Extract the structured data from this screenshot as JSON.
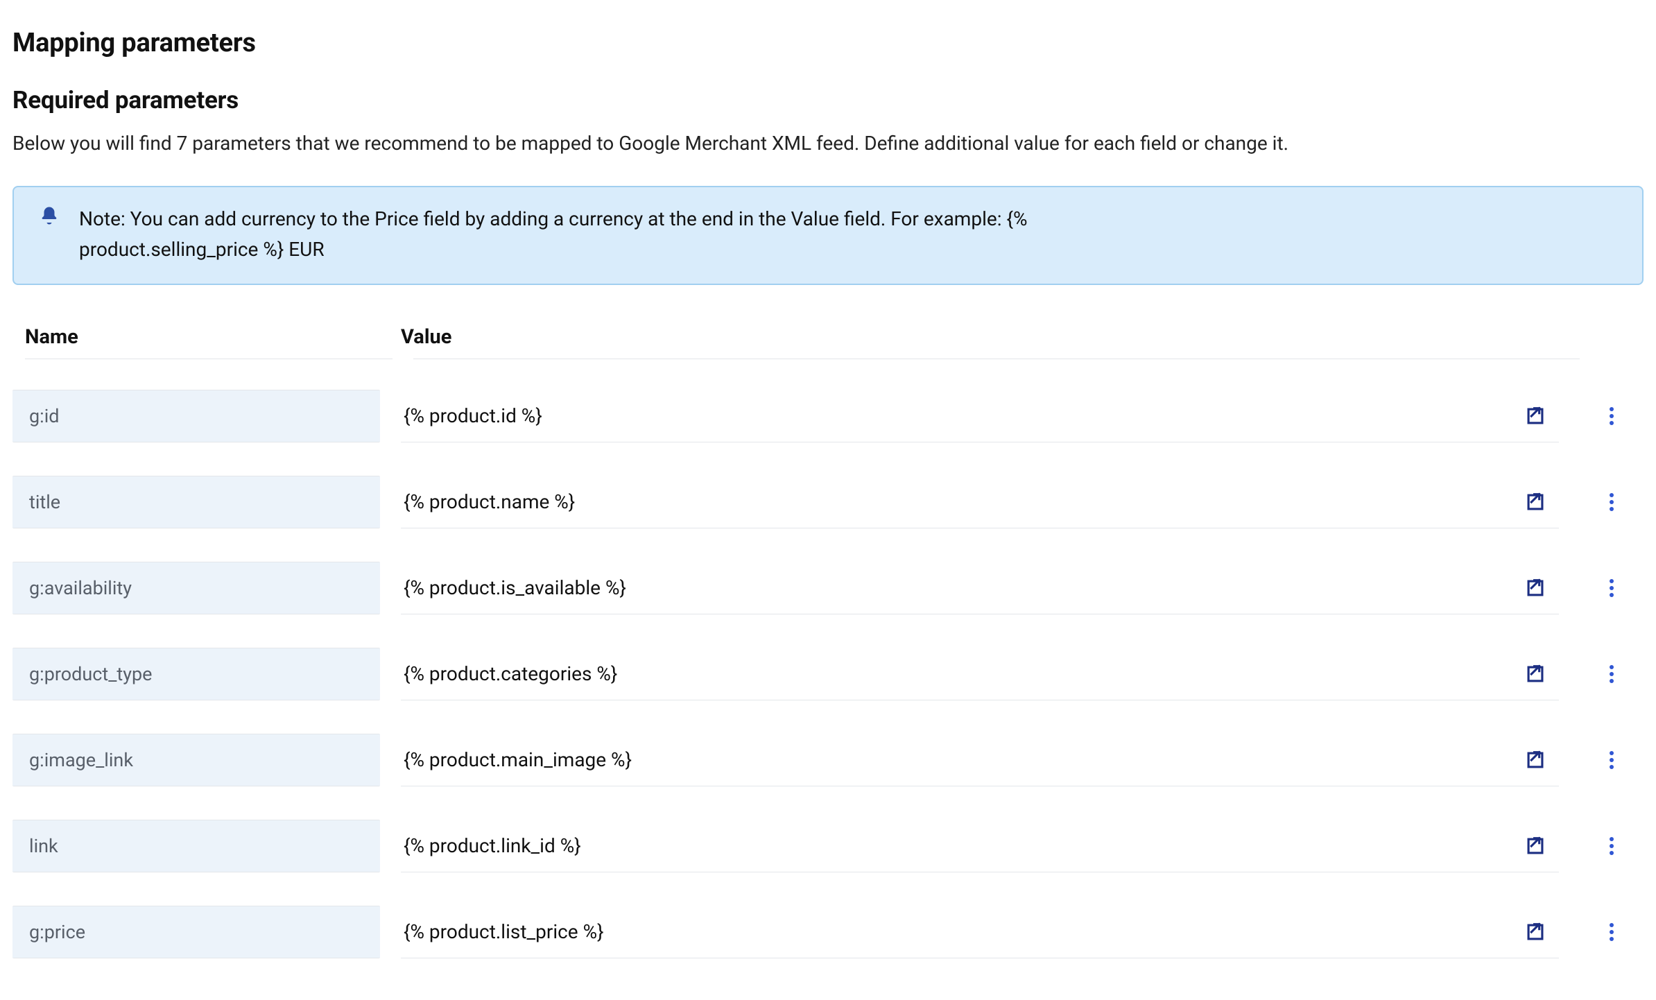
{
  "page": {
    "mapping_title": "Mapping parameters",
    "required_title": "Required parameters",
    "description": "Below you will find 7 parameters that we recommend to be mapped to Google Merchant XML feed. Define additional value for each field or change it."
  },
  "note": {
    "text": "Note: You can add currency to the Price field by adding a currency at the end in the Value field. For example: {% product.selling_price %} EUR"
  },
  "table": {
    "headers": {
      "name": "Name",
      "value": "Value"
    },
    "rows": [
      {
        "name": "g:id",
        "value": "{% product.id %}"
      },
      {
        "name": "title",
        "value": "{% product.name %}"
      },
      {
        "name": "g:availability",
        "value": "{% product.is_available %}"
      },
      {
        "name": "g:product_type",
        "value": "{% product.categories %}"
      },
      {
        "name": "g:image_link",
        "value": "{% product.main_image %}"
      },
      {
        "name": "link",
        "value": "{% product.link_id %}"
      },
      {
        "name": "g:price",
        "value": "{% product.list_price %}"
      }
    ]
  }
}
